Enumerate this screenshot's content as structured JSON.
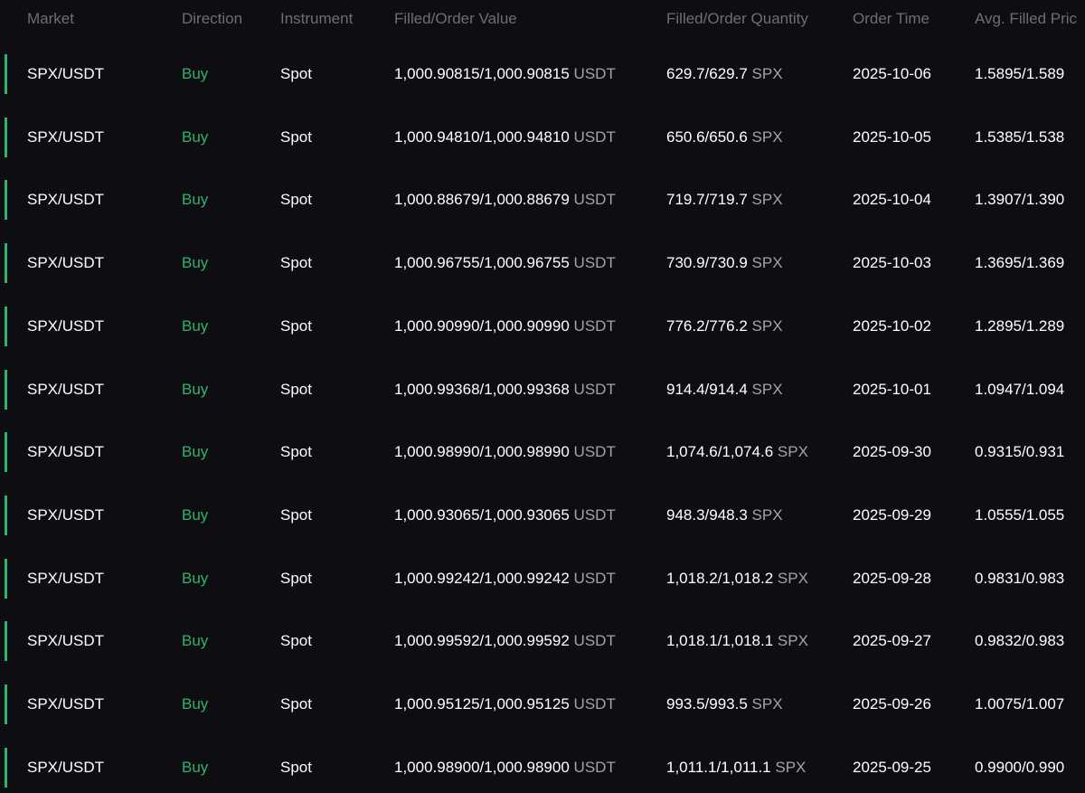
{
  "colors": {
    "background": "#0e0e12",
    "buy": "#2db36c",
    "header_text": "#6d6e75",
    "unit_text": "#a3a4ab",
    "row_accent": "#2db36c"
  },
  "columns": {
    "market": "Market",
    "direction": "Direction",
    "instrument": "Instrument",
    "filled_value": "Filled/Order Value",
    "filled_quantity": "Filled/Order Quantity",
    "order_time": "Order Time",
    "avg_price": "Avg. Filled Pric"
  },
  "rows": [
    {
      "market": "SPX/USDT",
      "direction": "Buy",
      "instrument": "Spot",
      "value": "1,000.90815/1,000.90815",
      "value_unit": "USDT",
      "qty": "629.7/629.7",
      "qty_unit": "SPX",
      "time": "2025-10-06",
      "avg": "1.5895/1.589"
    },
    {
      "market": "SPX/USDT",
      "direction": "Buy",
      "instrument": "Spot",
      "value": "1,000.94810/1,000.94810",
      "value_unit": "USDT",
      "qty": "650.6/650.6",
      "qty_unit": "SPX",
      "time": "2025-10-05",
      "avg": "1.5385/1.538"
    },
    {
      "market": "SPX/USDT",
      "direction": "Buy",
      "instrument": "Spot",
      "value": "1,000.88679/1,000.88679",
      "value_unit": "USDT",
      "qty": "719.7/719.7",
      "qty_unit": "SPX",
      "time": "2025-10-04",
      "avg": "1.3907/1.390"
    },
    {
      "market": "SPX/USDT",
      "direction": "Buy",
      "instrument": "Spot",
      "value": "1,000.96755/1,000.96755",
      "value_unit": "USDT",
      "qty": "730.9/730.9",
      "qty_unit": "SPX",
      "time": "2025-10-03",
      "avg": "1.3695/1.369"
    },
    {
      "market": "SPX/USDT",
      "direction": "Buy",
      "instrument": "Spot",
      "value": "1,000.90990/1,000.90990",
      "value_unit": "USDT",
      "qty": "776.2/776.2",
      "qty_unit": "SPX",
      "time": "2025-10-02",
      "avg": "1.2895/1.289"
    },
    {
      "market": "SPX/USDT",
      "direction": "Buy",
      "instrument": "Spot",
      "value": "1,000.99368/1,000.99368",
      "value_unit": "USDT",
      "qty": "914.4/914.4",
      "qty_unit": "SPX",
      "time": "2025-10-01",
      "avg": "1.0947/1.094"
    },
    {
      "market": "SPX/USDT",
      "direction": "Buy",
      "instrument": "Spot",
      "value": "1,000.98990/1,000.98990",
      "value_unit": "USDT",
      "qty": "1,074.6/1,074.6",
      "qty_unit": "SPX",
      "time": "2025-09-30",
      "avg": "0.9315/0.931"
    },
    {
      "market": "SPX/USDT",
      "direction": "Buy",
      "instrument": "Spot",
      "value": "1,000.93065/1,000.93065",
      "value_unit": "USDT",
      "qty": "948.3/948.3",
      "qty_unit": "SPX",
      "time": "2025-09-29",
      "avg": "1.0555/1.055"
    },
    {
      "market": "SPX/USDT",
      "direction": "Buy",
      "instrument": "Spot",
      "value": "1,000.99242/1,000.99242",
      "value_unit": "USDT",
      "qty": "1,018.2/1,018.2",
      "qty_unit": "SPX",
      "time": "2025-09-28",
      "avg": "0.9831/0.983"
    },
    {
      "market": "SPX/USDT",
      "direction": "Buy",
      "instrument": "Spot",
      "value": "1,000.99592/1,000.99592",
      "value_unit": "USDT",
      "qty": "1,018.1/1,018.1",
      "qty_unit": "SPX",
      "time": "2025-09-27",
      "avg": "0.9832/0.983"
    },
    {
      "market": "SPX/USDT",
      "direction": "Buy",
      "instrument": "Spot",
      "value": "1,000.95125/1,000.95125",
      "value_unit": "USDT",
      "qty": "993.5/993.5",
      "qty_unit": "SPX",
      "time": "2025-09-26",
      "avg": "1.0075/1.007"
    },
    {
      "market": "SPX/USDT",
      "direction": "Buy",
      "instrument": "Spot",
      "value": "1,000.98900/1,000.98900",
      "value_unit": "USDT",
      "qty": "1,011.1/1,011.1",
      "qty_unit": "SPX",
      "time": "2025-09-25",
      "avg": "0.9900/0.990"
    }
  ]
}
